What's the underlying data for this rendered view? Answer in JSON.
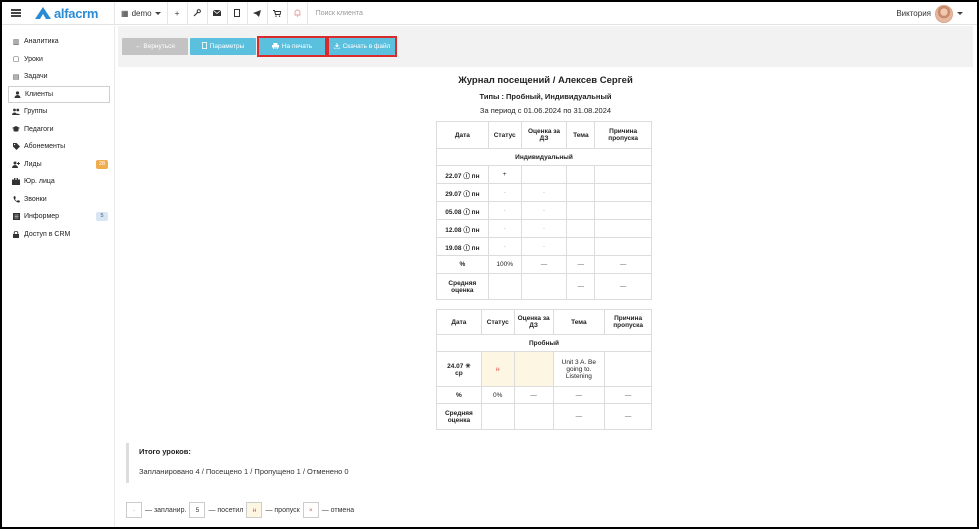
{
  "topbar": {
    "logo_text": "alfacrm",
    "branch": "demo",
    "search_placeholder": "Поиск клиента",
    "user_name": "Виктория",
    "icons": [
      "plus-icon",
      "wrench-icon",
      "envelope-icon",
      "clipboard-icon",
      "telegram-icon",
      "cart-icon",
      "bell-icon"
    ]
  },
  "sidebar": {
    "items": [
      {
        "label": "Аналитика",
        "icon": "chart-icon",
        "glyph": "▥"
      },
      {
        "label": "Уроки",
        "icon": "calendar-icon",
        "glyph": "▢"
      },
      {
        "label": "Задачи",
        "icon": "tasks-icon",
        "glyph": "▤"
      },
      {
        "label": "Клиенты",
        "icon": "user-icon",
        "glyph": "👤",
        "active": true
      },
      {
        "label": "Группы",
        "icon": "users-icon",
        "glyph": "👥"
      },
      {
        "label": "Педагоги",
        "icon": "graduation-cap-icon",
        "glyph": "🎓"
      },
      {
        "label": "Абонементы",
        "icon": "tag-icon",
        "glyph": "🏷"
      },
      {
        "label": "Лиды",
        "icon": "user-plus-icon",
        "glyph": "👤",
        "badge": "28"
      },
      {
        "label": "Юр. лица",
        "icon": "briefcase-icon",
        "glyph": "💼"
      },
      {
        "label": "Звонки",
        "icon": "phone-icon",
        "glyph": "📞"
      },
      {
        "label": "Информер",
        "icon": "list-icon",
        "glyph": "▦",
        "badge": "5"
      },
      {
        "label": "Доступ в CRM",
        "icon": "lock-icon",
        "glyph": "🔒"
      }
    ]
  },
  "toolbar": {
    "back": "← Вернуться",
    "params": "Параметры",
    "print": "На печать",
    "download": "Скачать в файл"
  },
  "report": {
    "title": "Журнал посещений / Алексев Сергей",
    "types": "Типы : Пробный, Индивидуальный",
    "period": "За период с 01.06.2024 по 31.08.2024",
    "headers": [
      "Дата",
      "Статус",
      "Оценка за ДЗ",
      "Тема",
      "Причина пропуска"
    ],
    "table1": {
      "section": "Индивидуальный",
      "rows": [
        {
          "date": "22.07",
          "day": "пн",
          "status": "+",
          "hw": "",
          "topic": "",
          "reason": ""
        },
        {
          "date": "29.07",
          "day": "пн",
          "status": "-",
          "hw": "-",
          "topic": "",
          "reason": ""
        },
        {
          "date": "05.08",
          "day": "пн",
          "status": "-",
          "hw": "-",
          "topic": "",
          "reason": ""
        },
        {
          "date": "12.08",
          "day": "пн",
          "status": "-",
          "hw": "-",
          "topic": "",
          "reason": ""
        },
        {
          "date": "19.08",
          "day": "пн",
          "status": "-",
          "hw": "-",
          "topic": "",
          "reason": ""
        }
      ],
      "pct_label": "%",
      "pct_value": "100%",
      "dash": "—",
      "avg_label": "Средняя оценка"
    },
    "table2": {
      "section": "Пробный",
      "rows": [
        {
          "date": "24.07",
          "day": "ср",
          "status": "н",
          "hw": "",
          "topic": "Unit 3 A. Be going to. Listening",
          "reason": ""
        }
      ],
      "pct_label": "%",
      "pct_value": "0%",
      "dash": "—",
      "avg_label": "Средняя оценка"
    },
    "summary_title": "Итого уроков:",
    "summary_text": "Запланировано 4 / Посещено 1 / Пропущено 1 / Отменено 0"
  },
  "legend": {
    "planned_symbol": "-",
    "planned": "— запланир.",
    "visited_symbol": "5",
    "visited": "— посетил",
    "missed_symbol": "н",
    "missed": "— пропуск",
    "cancelled_symbol": "×",
    "cancelled": "— отмена"
  },
  "colors": {
    "accent": "#5bc0de",
    "brand": "#2b8cd6",
    "highlight": "#d92b2b",
    "badge_orange": "#f0ad4e"
  }
}
